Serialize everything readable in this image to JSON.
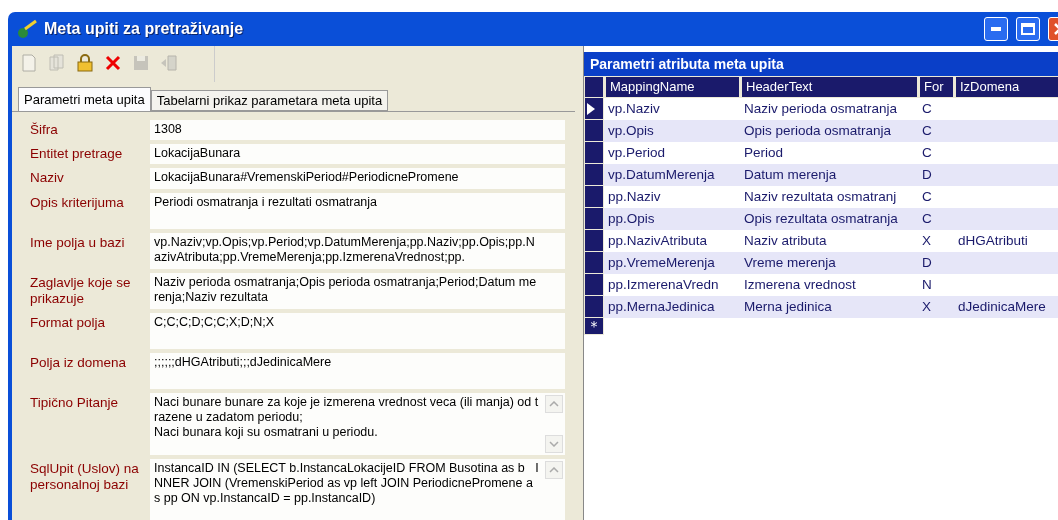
{
  "window": {
    "title": "Meta upiti za pretraživanje"
  },
  "toolbar": [
    {
      "kind": "new",
      "disabled": true
    },
    {
      "kind": "copy",
      "disabled": true
    },
    {
      "kind": "lock",
      "disabled": false
    },
    {
      "kind": "delete",
      "disabled": false
    },
    {
      "kind": "save",
      "disabled": true
    },
    {
      "kind": "exit",
      "disabled": true
    }
  ],
  "tabs": [
    {
      "label": "Parametri meta upita",
      "selected": true
    },
    {
      "label": "Tabelarni prikaz parametara meta upita",
      "selected": false
    }
  ],
  "fields": [
    {
      "label": "Šifra",
      "value": "1308",
      "kind": "line"
    },
    {
      "label": "Entitet pretrage",
      "value": "LokacijaBunara",
      "kind": "line"
    },
    {
      "label": "Naziv",
      "value": "LokacijaBunara#VremenskiPeriod#PeriodicnePromene",
      "kind": "line"
    },
    {
      "label": "Opis kriterijuma",
      "value": "Periodi osmatranja i rezultati osmatranja",
      "kind": "area"
    },
    {
      "label": "Ime polja u bazi",
      "value": "vp.Naziv;vp.Opis;vp.Period;vp.DatumMerenja;pp.Naziv;pp.Opis;pp.NazivAtributa;pp.VremeMerenja;pp.IzmerenaVrednost;pp.",
      "kind": "area"
    },
    {
      "label": "Zaglavlje koje se prikazuje",
      "value": "Naziv perioda osmatranja;Opis perioda osmatranja;Period;Datum merenja;Naziv rezultata",
      "kind": "area"
    },
    {
      "label": "Format polja",
      "value": "C;C;C;D;C;C;X;D;N;X",
      "kind": "area"
    },
    {
      "label": "Polja iz domena",
      "value": ";;;;;;dHGAtributi;;;dJedinicaMere",
      "kind": "area"
    },
    {
      "label": "Tipično Pitanje",
      "value": "Naci bunare bunare za koje je izmerena vrednost veca (ili manja) od trazene u zadatom periodu;\nNaci bunara koji su osmatrani u periodu.",
      "kind": "scroll"
    },
    {
      "label": "SqlUpit (Uslov) na personalnoj bazi",
      "value": "InstancaID IN (SELECT b.InstancaLokacijeID FROM Busotina as b   INNER JOIN (VremenskiPeriod as vp left JOIN PeriodicnePromene as pp ON vp.InstancaID = pp.InstancaID)",
      "kind": "scroll"
    }
  ],
  "grid": {
    "title": "Parametri atributa meta upita",
    "columns": [
      "MappingName",
      "HeaderText",
      "For",
      "IzDomena"
    ],
    "rows": [
      {
        "cells": [
          "vp.Naziv",
          "Naziv perioda osmatranja",
          "C",
          ""
        ],
        "selected": true
      },
      {
        "cells": [
          "vp.Opis",
          "Opis perioda osmatranja",
          "C",
          ""
        ],
        "selected": false
      },
      {
        "cells": [
          "vp.Period",
          "Period",
          "C",
          ""
        ],
        "selected": false
      },
      {
        "cells": [
          "vp.DatumMerenja",
          "Datum merenja",
          "D",
          ""
        ],
        "selected": false
      },
      {
        "cells": [
          "pp.Naziv",
          "Naziv rezultata osmatranj",
          "C",
          ""
        ],
        "selected": false
      },
      {
        "cells": [
          "pp.Opis",
          "Opis rezultata osmatranja",
          "C",
          ""
        ],
        "selected": false
      },
      {
        "cells": [
          "pp.NazivAtributa",
          "Naziv atributa",
          "X",
          "dHGAtributi"
        ],
        "selected": false
      },
      {
        "cells": [
          "pp.VremeMerenja",
          "Vreme merenja",
          "D",
          ""
        ],
        "selected": false
      },
      {
        "cells": [
          "pp.IzmerenaVredn",
          "Izmerena vrednost",
          "N",
          ""
        ],
        "selected": false
      },
      {
        "cells": [
          "pp.MernaJedinica",
          "Merna jedinica",
          "X",
          "dJedinicaMere"
        ],
        "selected": false
      }
    ],
    "new_row": "*"
  }
}
